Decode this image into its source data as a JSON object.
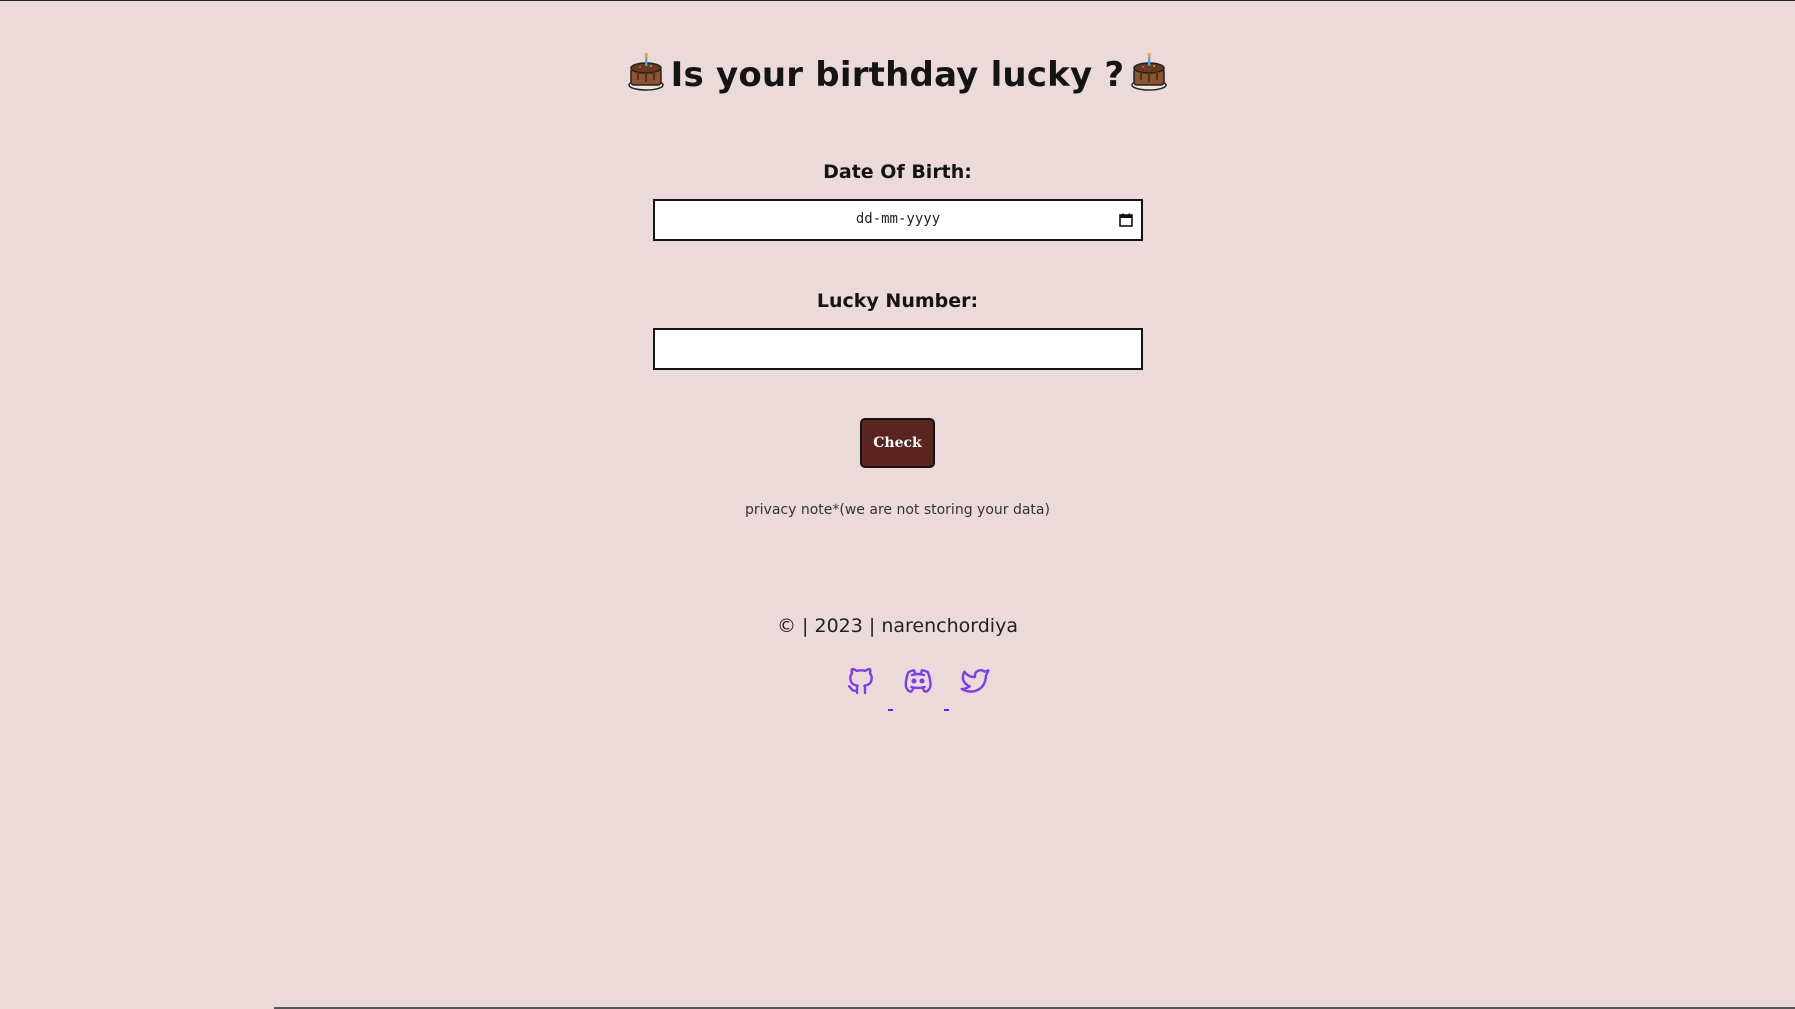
{
  "header": {
    "title": "Is your birthday lucky ?"
  },
  "form": {
    "dob_label": "Date Of Birth:",
    "dob_placeholder": "dd-mm-yyyy",
    "lucky_label": "Lucky Number:",
    "lucky_value": "",
    "check_label": "Check"
  },
  "privacy_note": "privacy note*(we are not storing your data)",
  "footer": {
    "copyright": "© | 2023 | narenchordiya",
    "links": [
      {
        "icon": "github-icon"
      },
      {
        "icon": "discord-icon"
      },
      {
        "icon": "twitter-icon"
      }
    ]
  },
  "colors": {
    "background": "#ecdadb",
    "button": "#5a2420",
    "icon": "#7b3fe4"
  }
}
